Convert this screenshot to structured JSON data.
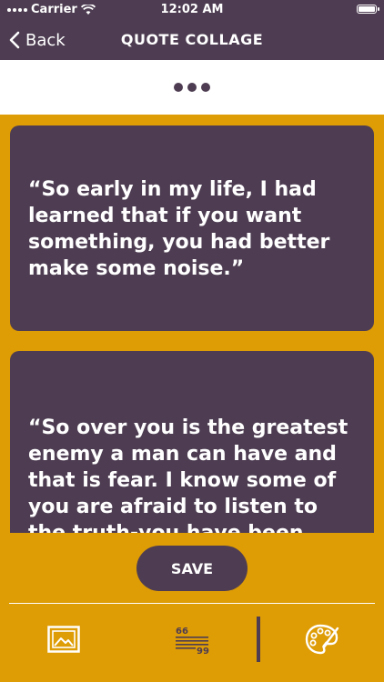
{
  "status_bar": {
    "carrier": "Carrier",
    "time": "12:02 AM"
  },
  "nav": {
    "back_label": "Back",
    "title": "QUOTE COLLAGE"
  },
  "quotes": [
    {
      "text": "“So early in my life, I had learned that if you want something, you had better make some noise.”"
    },
    {
      "text": "“So over you is the greatest enemy a man can have and that is fear. I know some of you are afraid to listen to the truth-you have been raised on"
    }
  ],
  "footer": {
    "save_label": "SAVE",
    "tools": [
      "image-icon",
      "quote-text-icon",
      "palette-icon"
    ]
  },
  "colors": {
    "primary": "#4E3D52",
    "background": "#DE9C05",
    "text_light": "#FFFFFF"
  }
}
